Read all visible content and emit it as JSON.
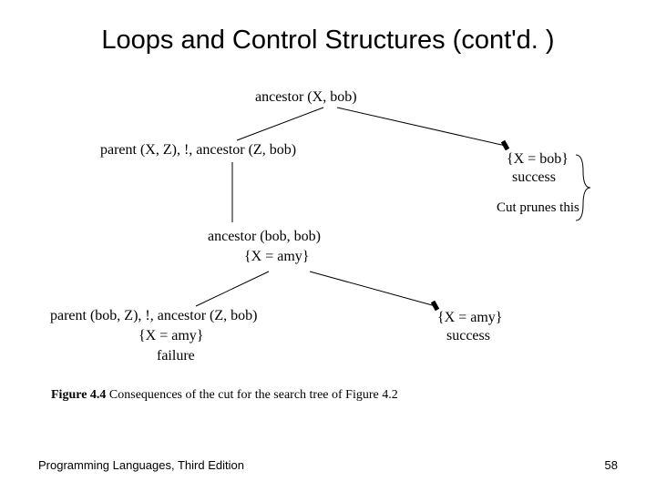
{
  "title": "Loops and Control Structures (cont'd. )",
  "tree": {
    "root": "ancestor (X, bob)",
    "left1": "parent (X, Z), !, ancestor (Z, bob)",
    "right1_binding": "{X = bob}",
    "right1_result": "success",
    "prune_note": "Cut prunes this",
    "mid": "ancestor (bob, bob)",
    "mid_binding": "{X = amy}",
    "left2": "parent (bob, Z), !, ancestor (Z, bob)",
    "left2_binding": "{X = amy}",
    "left2_result": "failure",
    "right2_binding": "{X = amy}",
    "right2_result": "success"
  },
  "figure": {
    "label": "Figure 4.4",
    "caption": "Consequences of the cut for the search tree of Figure 4.2"
  },
  "footer": {
    "left": "Programming Languages, Third Edition",
    "page": "58"
  }
}
